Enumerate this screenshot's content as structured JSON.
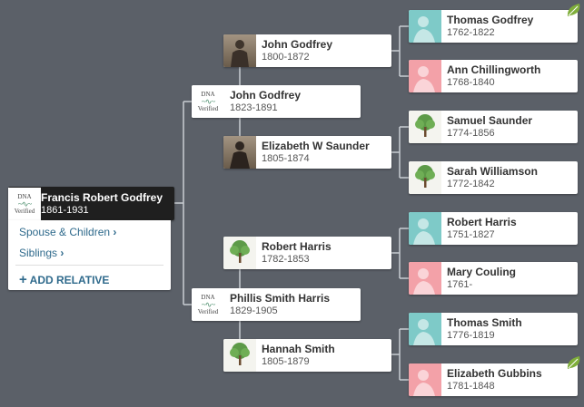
{
  "root": {
    "name": "Francis Robert Godfrey",
    "dates": "1861-1931",
    "badge": {
      "line1": "DNA",
      "line2": "Verified"
    },
    "menu": {
      "spouse_children": "Spouse & Children",
      "siblings": "Siblings",
      "add_relative": "ADD RELATIVE"
    }
  },
  "parents": [
    {
      "name": "John Godfrey",
      "dates": "1823-1891",
      "badge": {
        "line1": "DNA",
        "line2": "Verified"
      }
    },
    {
      "name": "Phillis Smith Harris",
      "dates": "1829-1905",
      "badge": {
        "line1": "DNA",
        "line2": "Verified"
      }
    }
  ],
  "grandparents": [
    {
      "name": "John Godfrey",
      "dates": "1800-1872",
      "pic": "photo-man"
    },
    {
      "name": "Elizabeth W Saunder",
      "dates": "1805-1874",
      "pic": "photo-woman"
    },
    {
      "name": "Robert Harris",
      "dates": "1782-1853",
      "pic": "tree-icon"
    },
    {
      "name": "Hannah Smith",
      "dates": "1805-1879",
      "pic": "tree-icon"
    }
  ],
  "great_grandparents": [
    {
      "name": "Thomas Godfrey",
      "dates": "1762-1822",
      "pic": "male-silhouette",
      "hint": true
    },
    {
      "name": "Ann Chillingworth",
      "dates": "1768-1840",
      "pic": "female-silhouette",
      "hint": false
    },
    {
      "name": "Samuel Saunder",
      "dates": "1774-1856",
      "pic": "tree-icon",
      "hint": false
    },
    {
      "name": "Sarah Williamson",
      "dates": "1772-1842",
      "pic": "tree-icon",
      "hint": false
    },
    {
      "name": "Robert Harris",
      "dates": "1751-1827",
      "pic": "male-silhouette",
      "hint": false
    },
    {
      "name": "Mary Couling",
      "dates": "1761-",
      "pic": "female-silhouette",
      "hint": false
    },
    {
      "name": "Thomas Smith",
      "dates": "1776-1819",
      "pic": "male-silhouette",
      "hint": false
    },
    {
      "name": "Elizabeth Gubbins",
      "dates": "1781-1848",
      "pic": "female-silhouette",
      "hint": true
    }
  ],
  "colors": {
    "background": "#5b6068",
    "connector": "#c9cdd2",
    "male": "#7ecac8",
    "female": "#f3a1a8",
    "leaf": "#7fae3a",
    "link": "#2f6a8c"
  }
}
